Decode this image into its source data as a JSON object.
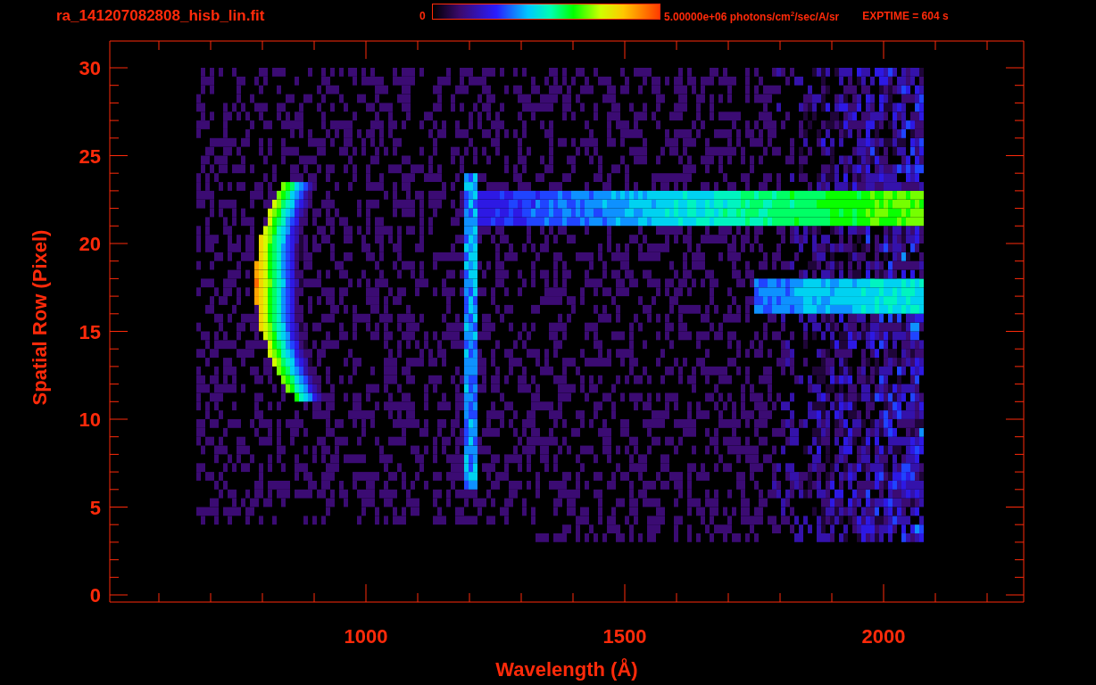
{
  "header": {
    "filename": "ra_141207082808_hisb_lin.fit",
    "scale_min": "0",
    "scale_max": "5.00000e+06 photons/cm$^{2}$/sec/A/sr",
    "exposure": "EXPTIME = 604 s"
  },
  "plot": {
    "ylabel": "Spatial Row (Pixel)",
    "xlabel": "Wavelength (Å)",
    "xticks": [
      "1000",
      "1500",
      "2000"
    ],
    "yticks": [
      "30",
      "25",
      "20",
      "15",
      "10",
      "5",
      "0"
    ]
  }
}
